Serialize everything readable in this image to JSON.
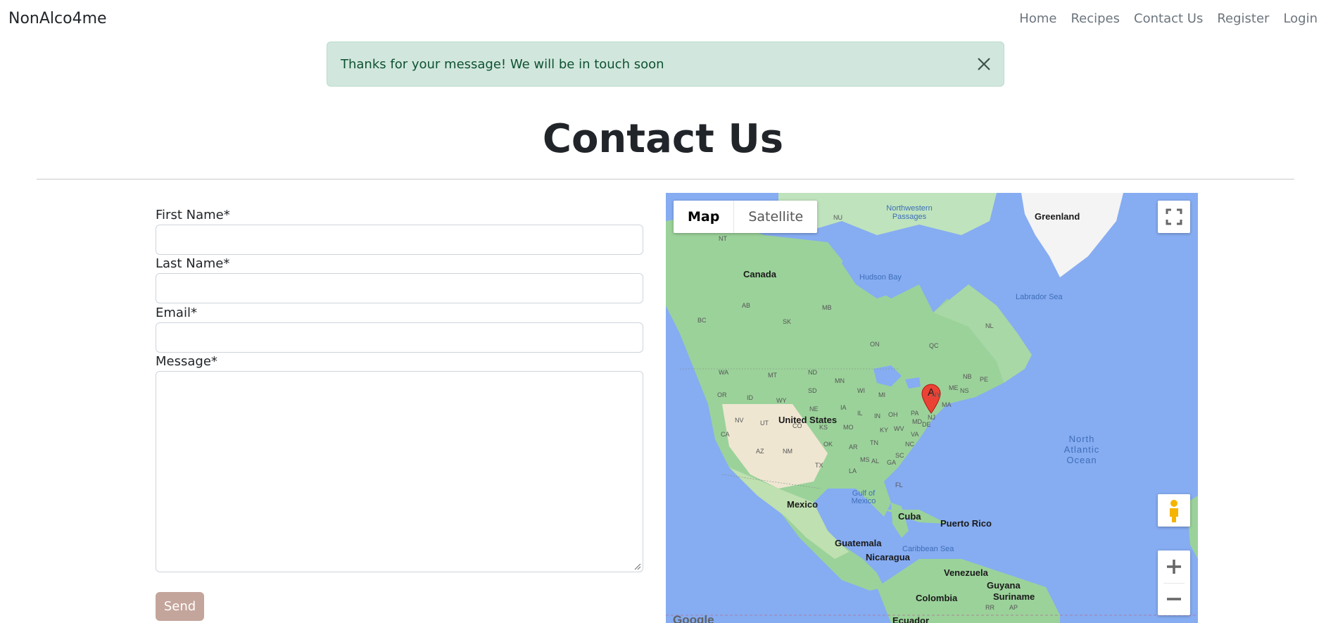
{
  "nav": {
    "brand": "NonAlco4me",
    "links": [
      "Home",
      "Recipes",
      "Contact Us",
      "Register",
      "Login"
    ]
  },
  "alert": {
    "message": "Thanks for your message! We will be in touch soon",
    "close_icon": "close-icon"
  },
  "page": {
    "title": "Contact Us"
  },
  "form": {
    "first_name_label": "First Name*",
    "last_name_label": "Last Name*",
    "email_label": "Email*",
    "message_label": "Message*",
    "send_label": "Send"
  },
  "map": {
    "type_buttons": [
      "Map",
      "Satellite"
    ],
    "marker_label": "A",
    "attribution": "Google",
    "labels": {
      "countries": [
        "Canada",
        "United States",
        "Mexico",
        "Greenland",
        "Cuba",
        "Puerto Rico",
        "Guatemala",
        "Nicaragua",
        "Venezuela",
        "Colombia",
        "Guyana",
        "Suriname",
        "Ecuador"
      ],
      "states": [
        "NT",
        "NU",
        "AB",
        "BC",
        "SK",
        "MB",
        "ON",
        "QC",
        "NL",
        "NB",
        "NS",
        "PE",
        "ME",
        "WA",
        "OR",
        "ID",
        "MT",
        "WY",
        "ND",
        "SD",
        "MN",
        "WI",
        "MI",
        "NE",
        "IA",
        "IL",
        "IN",
        "OH",
        "PA",
        "NY",
        "MA",
        "NJ",
        "DE",
        "MD",
        "VA",
        "WV",
        "KY",
        "TN",
        "NC",
        "SC",
        "GA",
        "AL",
        "MS",
        "LA",
        "AR",
        "MO",
        "KS",
        "OK",
        "TX",
        "NM",
        "AZ",
        "UT",
        "NV",
        "CA",
        "CO",
        "FL",
        "RR",
        "AP"
      ],
      "water": [
        "Northwestern Passages",
        "Hudson Bay",
        "Labrador Sea",
        "Gulf of Mexico",
        "Caribbean Sea"
      ],
      "ocean": [
        "North",
        "Atlantic",
        "Ocean"
      ]
    },
    "colors": {
      "water": "#86acf2",
      "land": "#9bd29a",
      "desert": "#efe6d2",
      "marker": "#ea4335"
    }
  }
}
